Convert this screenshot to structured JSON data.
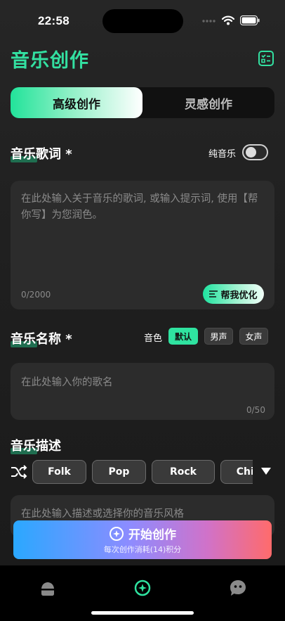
{
  "status_bar": {
    "time": "22:58"
  },
  "header": {
    "title": "音乐创作"
  },
  "tabs": [
    {
      "label": "高级创作",
      "active": true
    },
    {
      "label": "灵感创作",
      "active": false
    }
  ],
  "lyrics": {
    "title": "音乐歌词 *",
    "instrumental_label": "纯音乐",
    "instrumental_on": false,
    "placeholder": "在此处输入关于音乐的歌词, 或输入提示词, 使用【帮你写】为您润色。",
    "counter": "0/2000",
    "optimize_label": "帮我优化"
  },
  "song_name": {
    "title": "音乐名称 *",
    "tone_label": "音色",
    "tones": [
      "默认",
      "男声",
      "女声"
    ],
    "selected_tone": "默认",
    "placeholder": "在此处输入你的歌名",
    "counter": "0/50"
  },
  "description": {
    "title": "音乐描述",
    "styles": [
      "Folk",
      "Pop",
      "Rock",
      "Chine"
    ],
    "placeholder": "在此处输入描述或选择你的音乐风格"
  },
  "create_button": {
    "label": "开始创作",
    "sublabel": "每次创作消耗(14)积分"
  },
  "tabbar": {
    "items": [
      "home-icon",
      "create-icon",
      "chat-icon"
    ],
    "active": "create-icon"
  },
  "colors": {
    "accent": "#2fe3a0",
    "background": "#1f1f1f",
    "input_bg": "#2c2c2c"
  }
}
